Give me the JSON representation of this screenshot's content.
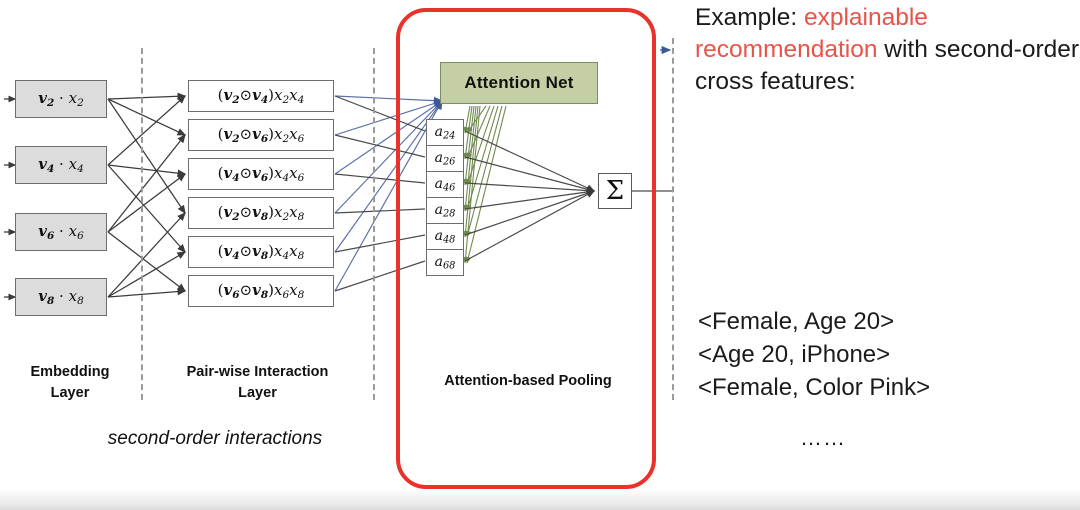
{
  "diagram": {
    "embedding_layer": {
      "label": "Embedding\nLayer",
      "label_line1": "Embedding",
      "label_line2": "Layer",
      "nodes": [
        {
          "vec": "v",
          "vec_sub": "2",
          "feat": "x",
          "feat_sub": "2",
          "text": "v2 · x2"
        },
        {
          "vec": "v",
          "vec_sub": "4",
          "feat": "x",
          "feat_sub": "4",
          "text": "v4 · x4"
        },
        {
          "vec": "v",
          "vec_sub": "6",
          "feat": "x",
          "feat_sub": "6",
          "text": "v6 · x6"
        },
        {
          "vec": "v",
          "vec_sub": "8",
          "feat": "x",
          "feat_sub": "8",
          "text": "v8 · x8"
        }
      ]
    },
    "pairwise_layer": {
      "label_line1": "Pair-wise Interaction",
      "label_line2": "Layer",
      "nodes": [
        {
          "a": "2",
          "b": "4",
          "text": "(v2 ⊙ v4)x2x4"
        },
        {
          "a": "2",
          "b": "6",
          "text": "(v2 ⊙ v6)x2x6"
        },
        {
          "a": "4",
          "b": "6",
          "text": "(v4 ⊙ v6)x4x6"
        },
        {
          "a": "2",
          "b": "8",
          "text": "(v2 ⊙ v8)x2x8"
        },
        {
          "a": "4",
          "b": "8",
          "text": "(v4 ⊙ v8)x4x8"
        },
        {
          "a": "6",
          "b": "8",
          "text": "(v6 ⊙ v8)x6x8"
        }
      ]
    },
    "pooling_layer": {
      "label": "Attention-based Pooling",
      "attention_net_label": "Attention Net",
      "sum_symbol": "Σ",
      "attention_weights": [
        {
          "sub": "24",
          "text": "a24"
        },
        {
          "sub": "26",
          "text": "a26"
        },
        {
          "sub": "46",
          "text": "a46"
        },
        {
          "sub": "28",
          "text": "a28"
        },
        {
          "sub": "48",
          "text": "a48"
        },
        {
          "sub": "68",
          "text": "a68"
        }
      ]
    },
    "caption": "second-order interactions",
    "colors": {
      "highlight_region": "#e8322a",
      "attention_net_fill": "#c5cfa6",
      "attention_net_border": "#7d8c5c",
      "embedding_fill": "#dcdcdc",
      "attention_edges": "#6f8a4f",
      "input_edges": "#5a6ea8",
      "plain_edges": "#4a4a4a"
    }
  },
  "example": {
    "headline_part1": "Example: ",
    "headline_accent": "explainable recommendation",
    "headline_part2": " with second-order cross features:",
    "cross_features": [
      "<Female, Age 20>",
      "<Age 20, iPhone>",
      "<Female, Color Pink>"
    ],
    "ellipsis": "……",
    "item_image": "iphone-6s-rose-gold-photo",
    "arrow_icon": "right-block-arrow-icon",
    "user_avatar": "female-user-avatar",
    "accent_color": "#e8534a"
  }
}
